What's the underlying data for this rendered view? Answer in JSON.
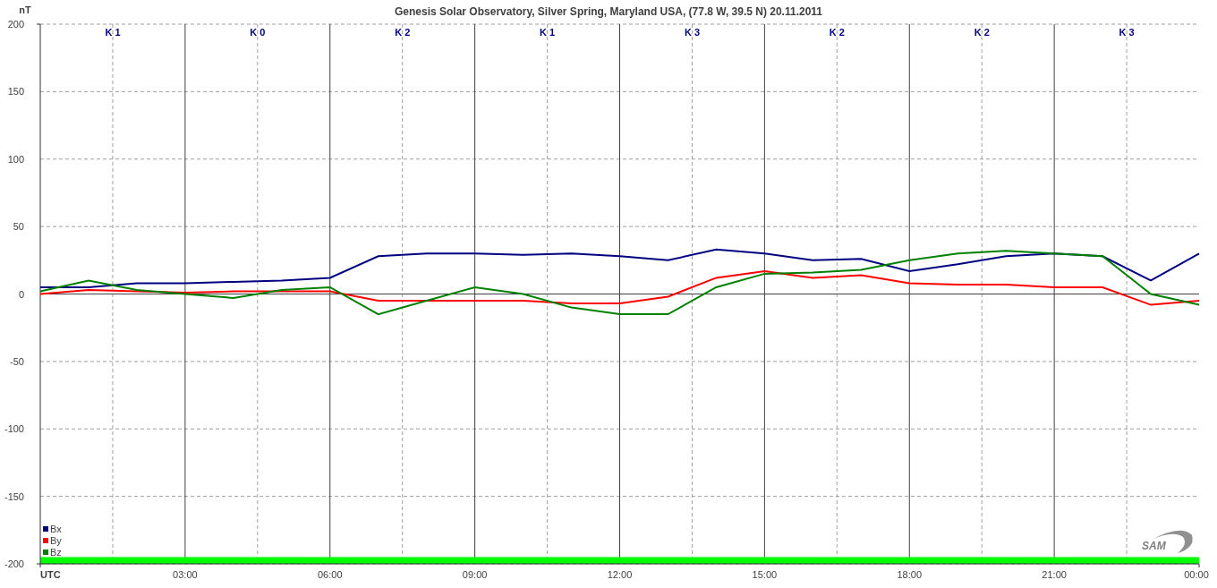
{
  "chart": {
    "chart_data": {
      "type": "line",
      "title": "Genesis Solar Observatory, Silver Spring, Maryland USA, (77.8 W, 39.5 N)  20.11.2011",
      "xlabel": "UTC",
      "ylabel": "nT",
      "x": [
        0,
        1,
        2,
        3,
        4,
        5,
        6,
        7,
        8,
        9,
        10,
        11,
        12,
        13,
        14,
        15,
        16,
        17,
        18,
        19,
        20,
        21,
        22,
        23,
        24
      ],
      "series": [
        {
          "name": "Bx",
          "color": "#000080",
          "values": [
            5,
            5,
            8,
            8,
            9,
            10,
            12,
            28,
            30,
            30,
            29,
            30,
            28,
            25,
            33,
            30,
            25,
            26,
            17,
            22,
            28,
            30,
            28,
            10,
            30
          ]
        },
        {
          "name": "By",
          "color": "#ff0000",
          "values": [
            0,
            3,
            2,
            1,
            2,
            2,
            2,
            -5,
            -5,
            -5,
            -5,
            -7,
            -7,
            -2,
            12,
            17,
            12,
            14,
            8,
            7,
            7,
            5,
            5,
            -8,
            -5
          ]
        },
        {
          "name": "Bz",
          "color": "#008000",
          "values": [
            2,
            10,
            3,
            0,
            -3,
            3,
            5,
            -15,
            -5,
            5,
            0,
            -10,
            -15,
            -15,
            5,
            15,
            16,
            18,
            25,
            30,
            32,
            30,
            28,
            0,
            -8
          ]
        }
      ],
      "xlim": [
        0,
        24
      ],
      "ylim": [
        -200,
        200
      ],
      "xticks": [
        {
          "value": 3,
          "label": "03:00"
        },
        {
          "value": 6,
          "label": "06:00"
        },
        {
          "value": 9,
          "label": "09:00"
        },
        {
          "value": 12,
          "label": "12:00"
        },
        {
          "value": 15,
          "label": "15:00"
        },
        {
          "value": 18,
          "label": "18:00"
        },
        {
          "value": 21,
          "label": "21:00"
        },
        {
          "value": 24,
          "label": "00:00"
        }
      ],
      "yticks": [
        -200,
        -150,
        -100,
        -50,
        0,
        50,
        100,
        150,
        200
      ],
      "grid": true,
      "legend": "lower left",
      "bands": [
        {
          "axis": "y",
          "from": -200,
          "to": -195,
          "color": "#00ff00"
        }
      ],
      "annotations": [
        "K 1",
        "K 0",
        "K 2",
        "K 1",
        "K 3",
        "K 2",
        "K 2",
        "K 3"
      ]
    },
    "logo_text": "SAM"
  }
}
